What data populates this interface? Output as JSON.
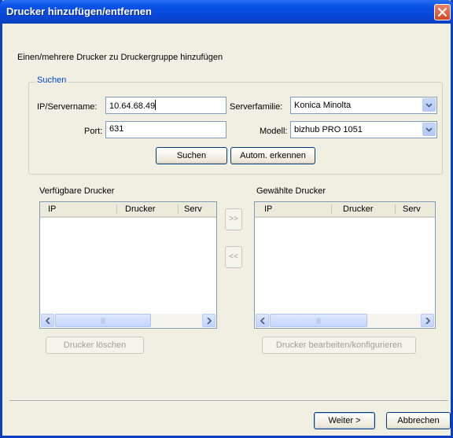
{
  "window": {
    "title": "Drucker hinzufügen/entfernen"
  },
  "instruction": "Einen/mehrere Drucker zu Druckergruppe hinzufügen",
  "search_group": {
    "legend": "Suchen",
    "ip_label": "IP/Servername:",
    "ip_value": "10.64.68.49",
    "port_label": "Port:",
    "port_value": "631",
    "family_label": "Serverfamilie:",
    "family_value": "Konica Minolta",
    "model_label": "Modell:",
    "model_value": "bizhub PRO 1051",
    "search_button": "Suchen",
    "auto_button": "Autom. erkennen"
  },
  "available": {
    "label": "Verfügbare Drucker",
    "columns": [
      "IP",
      "Drucker",
      "Serv"
    ],
    "delete_button": "Drucker löschen"
  },
  "selected": {
    "label": "Gewählte Drucker",
    "columns": [
      "IP",
      "Drucker",
      "Serv"
    ],
    "edit_button": "Drucker bearbeiten/konfigurieren"
  },
  "move": {
    "add_label": ">>",
    "remove_label": "<<"
  },
  "footer": {
    "next_button": "Weiter >",
    "cancel_button": "Abbrechen"
  },
  "icons": {
    "close": "close-icon",
    "dropdown": "chevron-down-icon",
    "scroll_left": "arrow-left-icon",
    "scroll_right": "arrow-right-icon"
  },
  "colors": {
    "titlebar": "#0a50dc",
    "legend": "#0046d5",
    "close": "#d2461e"
  }
}
